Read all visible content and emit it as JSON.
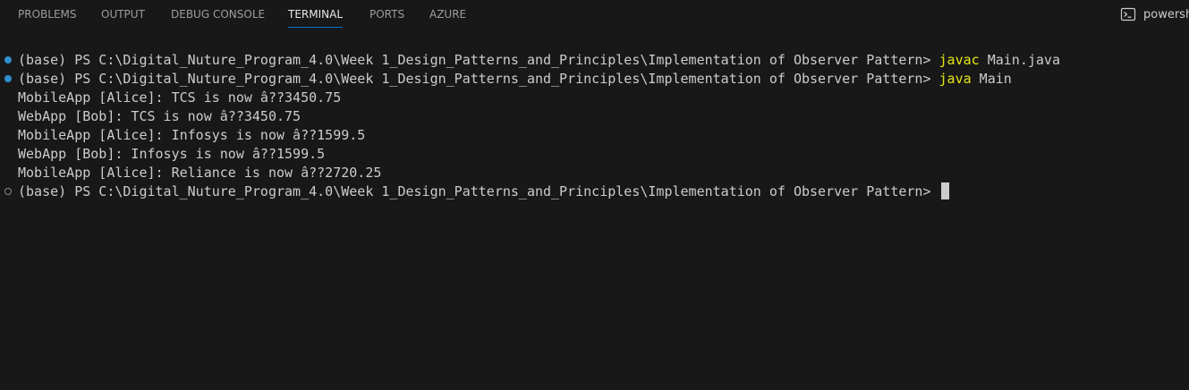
{
  "tabs": [
    {
      "label": "PROBLEMS",
      "active": false
    },
    {
      "label": "OUTPUT",
      "active": false
    },
    {
      "label": "DEBUG CONSOLE",
      "active": false
    },
    {
      "label": "TERMINAL",
      "active": true
    },
    {
      "label": "PORTS",
      "active": false
    },
    {
      "label": "AZURE",
      "active": false
    }
  ],
  "shell": {
    "icon": "terminal-icon",
    "label": "powersh"
  },
  "terminal": {
    "prompt": "(base) PS C:\\Digital_Nuture_Program_4.0\\Week 1_Design_Patterns_and_Principles\\Implementation of Observer Pattern> ",
    "command1": {
      "name": "javac",
      "args": " Main.java"
    },
    "command2": {
      "name": "java",
      "args": " Main"
    },
    "output": [
      "MobileApp [Alice]: TCS is now â??3450.75",
      "WebApp [Bob]: TCS is now â??3450.75",
      "MobileApp [Alice]: Infosys is now â??1599.5",
      "WebApp [Bob]: Infosys is now â??1599.5",
      "MobileApp [Alice]: Reliance is now â??2720.25"
    ]
  },
  "colors": {
    "background": "#181818",
    "active_tab_underline": "#0078d4",
    "command_highlight": "#e5e510",
    "decoration_success": "#2f8fce"
  }
}
